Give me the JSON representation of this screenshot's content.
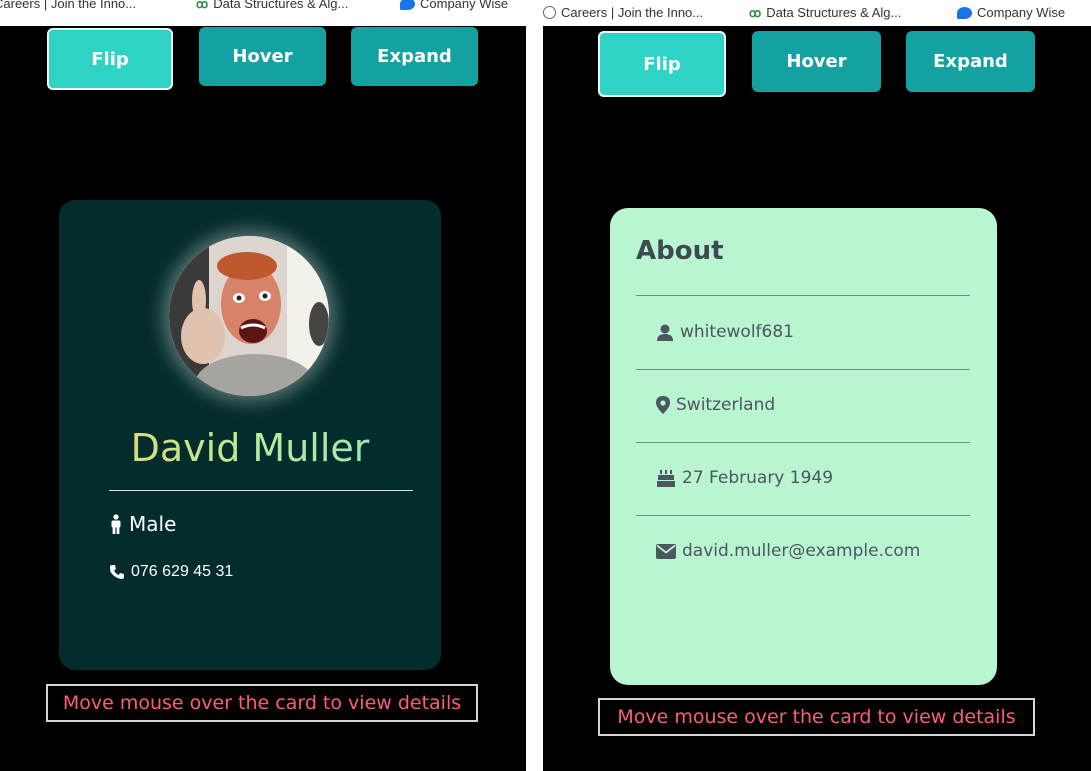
{
  "bookmarks": {
    "careers": "Careers | Join the Inno...",
    "dsa": "Data Structures & Alg...",
    "company": "Company Wise"
  },
  "toolbar": {
    "flip_label": "Flip",
    "hover_label": "Hover",
    "expand_label": "Expand",
    "active": "Flip"
  },
  "profile": {
    "name": "David Muller",
    "gender": "Male",
    "phone": "076 629 45 31"
  },
  "about": {
    "title": "About",
    "username": "whitewolf681",
    "location": "Switzerland",
    "birthday": "27 February 1949",
    "email": "david.muller@example.com"
  },
  "hint": "Move mouse over the card to view details",
  "icons": [
    "globe-icon",
    "gfg-icon",
    "chat-icon",
    "user-icon",
    "map-marker-icon",
    "birthday-cake-icon",
    "envelope-icon",
    "male-icon",
    "phone-icon"
  ],
  "colors": {
    "button": "#13a1a1",
    "button_active": "#2ed3c6",
    "front_card": "#042c2c",
    "back_card": "#baf5d1",
    "hint_text": "#ff5c7a"
  }
}
